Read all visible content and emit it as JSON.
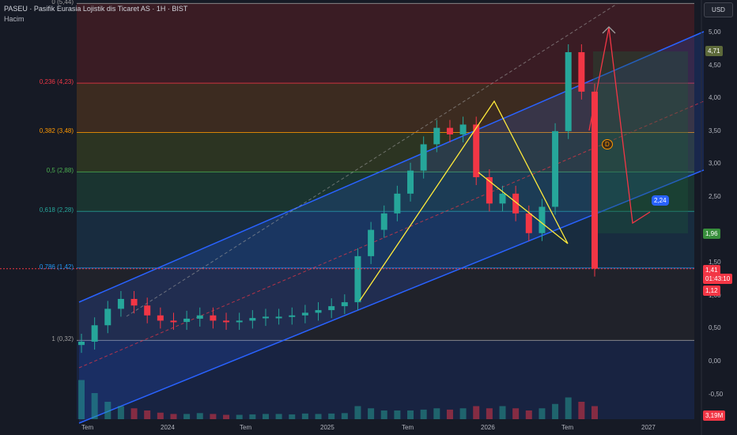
{
  "header": {
    "title": "PASEU · Pasifik Eurasia Lojistik dis Ticaret AS · 1H · BIST",
    "volume_label": "Hacim"
  },
  "currency_button": "USD",
  "fib_levels": [
    {
      "label": "0 (5,44)",
      "value": 5.44,
      "color": "#9e9e9e"
    },
    {
      "label": "0,236 (4,23)",
      "value": 4.23,
      "color": "#f23645"
    },
    {
      "label": "0,382 (3,48)",
      "value": 3.48,
      "color": "#ff9800"
    },
    {
      "label": "0,5 (2,88)",
      "value": 2.88,
      "color": "#4caf50"
    },
    {
      "label": "0,618 (2,28)",
      "value": 2.28,
      "color": "#26a69a"
    },
    {
      "label": "0,786 (1,42)",
      "value": 1.42,
      "color": "#2196f3"
    },
    {
      "label": "1 (0,32)",
      "value": 0.32,
      "color": "#9e9e9e"
    }
  ],
  "y_ticks": [
    "5,00",
    "4,50",
    "4,00",
    "3,50",
    "3,00",
    "2,50",
    "1,50",
    "1,00",
    "0,50",
    "0,00",
    "-0,50"
  ],
  "x_ticks": [
    "Tem",
    "2024",
    "Tem",
    "2025",
    "Tem",
    "2026",
    "Tem",
    "2027"
  ],
  "price_badges": {
    "upper": "4,71",
    "lower": "1,96",
    "current": "1,41",
    "countdown": "01:43:10",
    "low": "1,12",
    "volume": "3,19M",
    "target": "2,24",
    "pattern_point": "D"
  },
  "chart_data": {
    "type": "candlestick",
    "title": "PASEU · Pasifik Eurasia Lojistik dis Ticaret AS · 1H · BIST",
    "ylabel": "USD",
    "ylim": [
      -0.7,
      5.5
    ],
    "x": [
      "2023-05",
      "2023-06",
      "2023-07",
      "2023-08",
      "2023-09",
      "2023-10",
      "2023-11",
      "2023-12",
      "2024-01",
      "2024-02",
      "2024-03",
      "2024-04",
      "2024-05",
      "2024-06",
      "2024-07",
      "2024-08",
      "2024-09",
      "2024-10",
      "2024-11",
      "2024-12",
      "2025-01",
      "2025-02",
      "2025-03",
      "2025-04",
      "2025-05",
      "2025-06",
      "2025-07",
      "2025-08",
      "2025-09",
      "2025-10",
      "2025-11",
      "2025-12",
      "2026-01",
      "2026-02",
      "2026-03",
      "2026-04",
      "2026-05",
      "2026-06",
      "2026-07",
      "2026-08"
    ],
    "close": [
      0.3,
      0.55,
      0.8,
      0.95,
      0.85,
      0.7,
      0.62,
      0.6,
      0.65,
      0.7,
      0.62,
      0.6,
      0.62,
      0.66,
      0.68,
      0.68,
      0.7,
      0.74,
      0.78,
      0.84,
      0.9,
      1.6,
      2.0,
      2.25,
      2.55,
      2.9,
      3.3,
      3.55,
      3.45,
      3.6,
      2.8,
      2.4,
      2.55,
      2.25,
      1.95,
      2.35,
      3.5,
      4.7,
      4.1,
      1.41
    ],
    "volume": [
      0.9,
      0.6,
      0.4,
      0.3,
      0.25,
      0.2,
      0.15,
      0.12,
      0.12,
      0.14,
      0.12,
      0.1,
      0.1,
      0.11,
      0.12,
      0.12,
      0.11,
      0.13,
      0.12,
      0.13,
      0.14,
      0.3,
      0.25,
      0.2,
      0.2,
      0.2,
      0.22,
      0.25,
      0.22,
      0.25,
      0.3,
      0.25,
      0.3,
      0.25,
      0.2,
      0.25,
      0.35,
      0.5,
      0.4,
      0.3
    ]
  },
  "colors": {
    "up": "#26a69a",
    "down": "#f23645",
    "channel": "#2962ff",
    "pattern": "#ffeb3b",
    "projection": "#f23645"
  }
}
